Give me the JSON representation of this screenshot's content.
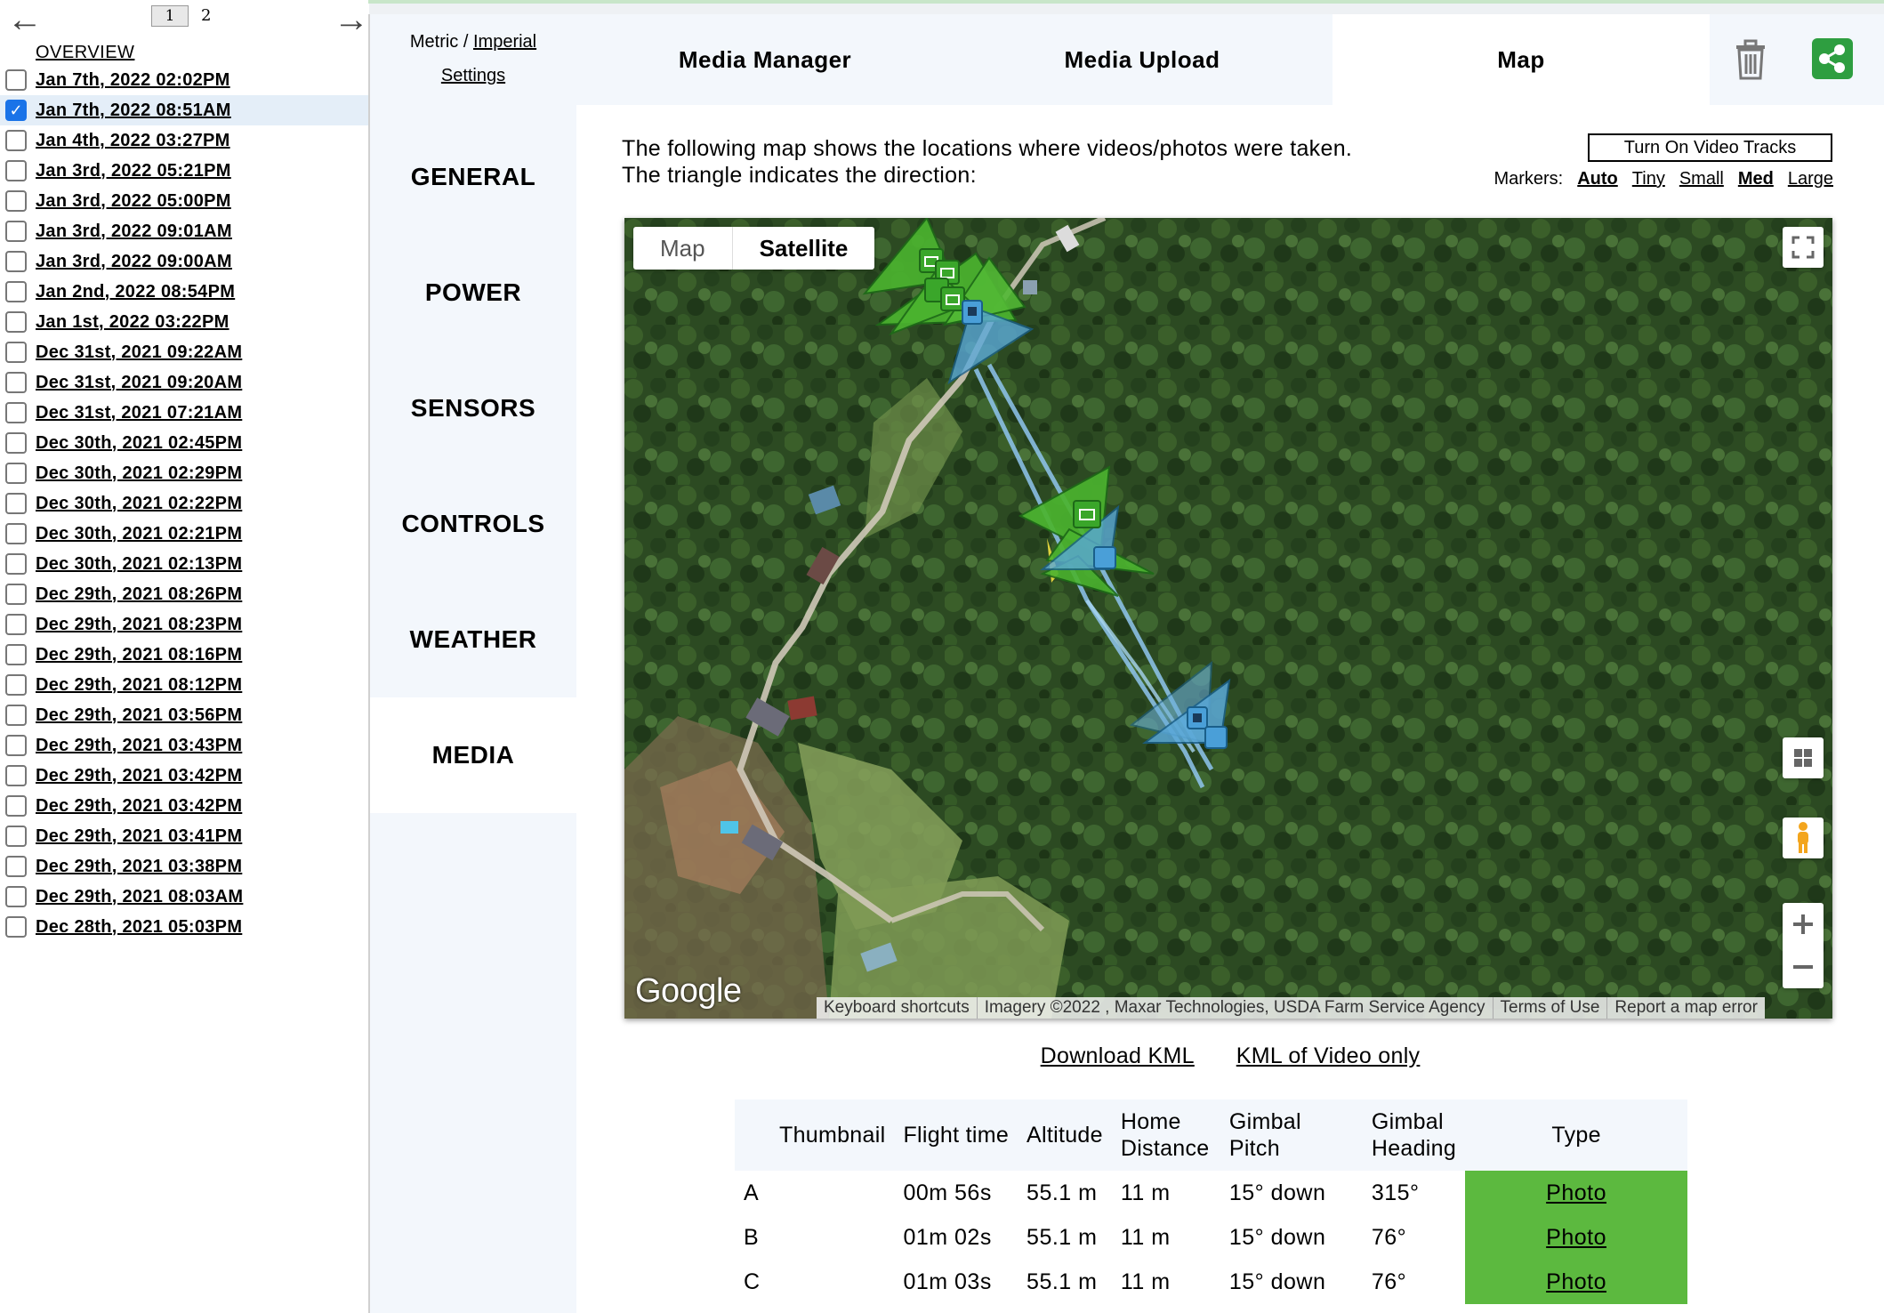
{
  "pagination": {
    "back_icon": "arrow-left-icon",
    "forward_icon": "arrow-right-icon",
    "pages": [
      "1",
      "2"
    ],
    "current_page": "1"
  },
  "sidebar": {
    "overview": "OVERVIEW",
    "flights": [
      {
        "label": "Jan 7th, 2022 02:02PM",
        "checked": false
      },
      {
        "label": "Jan 7th, 2022 08:51AM",
        "checked": true
      },
      {
        "label": "Jan 4th, 2022 03:27PM",
        "checked": false
      },
      {
        "label": "Jan 3rd, 2022 05:21PM",
        "checked": false
      },
      {
        "label": "Jan 3rd, 2022 05:00PM",
        "checked": false
      },
      {
        "label": "Jan 3rd, 2022 09:01AM",
        "checked": false
      },
      {
        "label": "Jan 3rd, 2022 09:00AM",
        "checked": false
      },
      {
        "label": "Jan 2nd, 2022 08:54PM",
        "checked": false
      },
      {
        "label": "Jan 1st, 2022 03:22PM",
        "checked": false
      },
      {
        "label": "Dec 31st, 2021 09:22AM",
        "checked": false
      },
      {
        "label": "Dec 31st, 2021 09:20AM",
        "checked": false
      },
      {
        "label": "Dec 31st, 2021 07:21AM",
        "checked": false
      },
      {
        "label": "Dec 30th, 2021 02:45PM",
        "checked": false
      },
      {
        "label": "Dec 30th, 2021 02:29PM",
        "checked": false
      },
      {
        "label": "Dec 30th, 2021 02:22PM",
        "checked": false
      },
      {
        "label": "Dec 30th, 2021 02:21PM",
        "checked": false
      },
      {
        "label": "Dec 30th, 2021 02:13PM",
        "checked": false
      },
      {
        "label": "Dec 29th, 2021 08:26PM",
        "checked": false
      },
      {
        "label": "Dec 29th, 2021 08:23PM",
        "checked": false
      },
      {
        "label": "Dec 29th, 2021 08:16PM",
        "checked": false
      },
      {
        "label": "Dec 29th, 2021 08:12PM",
        "checked": false
      },
      {
        "label": "Dec 29th, 2021 03:56PM",
        "checked": false
      },
      {
        "label": "Dec 29th, 2021 03:43PM",
        "checked": false
      },
      {
        "label": "Dec 29th, 2021 03:42PM",
        "checked": false
      },
      {
        "label": "Dec 29th, 2021 03:42PM",
        "checked": false
      },
      {
        "label": "Dec 29th, 2021 03:41PM",
        "checked": false
      },
      {
        "label": "Dec 29th, 2021 03:38PM",
        "checked": false
      },
      {
        "label": "Dec 29th, 2021 08:03AM",
        "checked": false
      },
      {
        "label": "Dec 28th, 2021 05:03PM",
        "checked": false
      }
    ]
  },
  "settings": {
    "metric": "Metric",
    "separator": " / ",
    "imperial": "Imperial",
    "settings_link": "Settings",
    "sections": [
      "GENERAL",
      "POWER",
      "SENSORS",
      "CONTROLS",
      "WEATHER",
      "MEDIA"
    ],
    "active_section": "MEDIA"
  },
  "tabs": {
    "items": [
      "Media Manager",
      "Media Upload",
      "Map"
    ],
    "active": "Map",
    "trash_icon": "trash-icon",
    "share_icon": "share-icon",
    "accent_color": "#2e9e40"
  },
  "map_panel": {
    "intro_line1": "The following map shows the locations where videos/photos were taken.",
    "intro_line2": "The triangle indicates the direction:",
    "video_tracks_button": "Turn On Video Tracks",
    "markers_label": "Markers:",
    "marker_sizes": [
      "Auto",
      "Tiny",
      "Small",
      "Med",
      "Large"
    ],
    "marker_bold": [
      "Auto",
      "Med"
    ],
    "map_types": [
      "Map",
      "Satellite"
    ],
    "active_map_type": "Satellite",
    "google_logo": "Google",
    "attribution": [
      "Keyboard shortcuts",
      "Imagery ©2022 , Maxar Technologies, USDA Farm Service Agency",
      "Terms of Use",
      "Report a map error"
    ],
    "icons": [
      "fullscreen-icon",
      "layers-icon",
      "pegman-icon",
      "zoom-in-icon",
      "zoom-out-icon",
      "camera-icon",
      "video-icon"
    ],
    "photo_color": "#3aa62a",
    "video_color": "#4a9fd8"
  },
  "kml": {
    "download": "Download KML",
    "video_only": "KML of Video only"
  },
  "media_table": {
    "headers": [
      "",
      "Thumbnail",
      "Flight time",
      "Altitude",
      "Home Distance",
      "Gimbal Pitch",
      "Gimbal Heading",
      "Type"
    ],
    "rows": [
      {
        "id": "A",
        "thumbnail": "",
        "flight_time": "00m 56s",
        "altitude": "55.1 m",
        "home_distance": "11 m",
        "gimbal_pitch": "15° down",
        "gimbal_heading": "315°",
        "type": "Photo"
      },
      {
        "id": "B",
        "thumbnail": "",
        "flight_time": "01m 02s",
        "altitude": "55.1 m",
        "home_distance": "11 m",
        "gimbal_pitch": "15° down",
        "gimbal_heading": "76°",
        "type": "Photo"
      },
      {
        "id": "C",
        "thumbnail": "",
        "flight_time": "01m 03s",
        "altitude": "55.1 m",
        "home_distance": "11 m",
        "gimbal_pitch": "15° down",
        "gimbal_heading": "76°",
        "type": "Photo"
      }
    ],
    "type_color": "#5cb93f"
  }
}
